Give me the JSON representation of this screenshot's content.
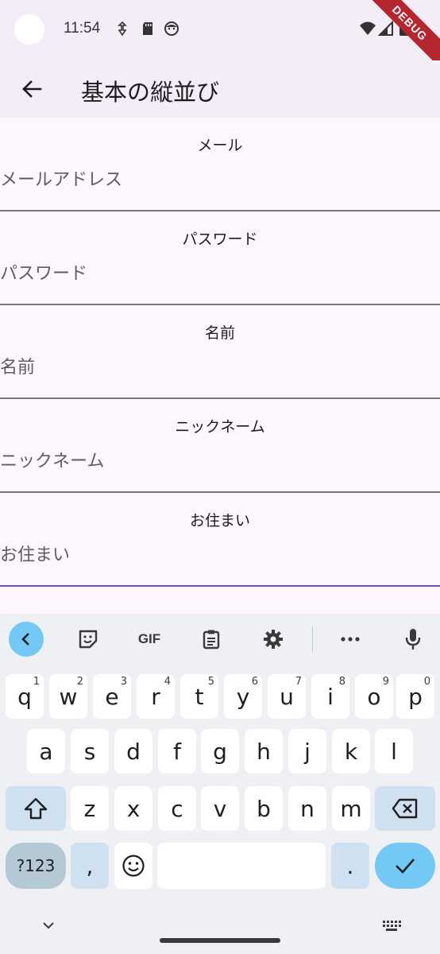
{
  "status_bar": {
    "time": "11:54",
    "icons": [
      "navigation-icon",
      "sd-card-icon",
      "face-icon",
      "wifi-icon",
      "signal-icon",
      "battery-icon"
    ],
    "debug_label": "DEBUG"
  },
  "app_bar": {
    "title": "基本の縦並び",
    "back_icon": "arrow-back-icon"
  },
  "form": {
    "fields": [
      {
        "label": "メール",
        "placeholder": "メールアドレス"
      },
      {
        "label": "パスワード",
        "placeholder": "パスワード"
      },
      {
        "label": "名前",
        "placeholder": "名前"
      },
      {
        "label": "ニックネーム",
        "placeholder": "ニックネーム"
      },
      {
        "label": "お住まい",
        "placeholder": "お住まい"
      }
    ]
  },
  "keyboard": {
    "toolbar": [
      "chevron-left-icon",
      "sticker-icon",
      "gif-icon",
      "clipboard-icon",
      "settings-icon",
      "more-icon",
      "mic-icon"
    ],
    "gif_label": "GIF",
    "row1": [
      {
        "k": "q",
        "h": "1"
      },
      {
        "k": "w",
        "h": "2"
      },
      {
        "k": "e",
        "h": "3"
      },
      {
        "k": "r",
        "h": "4"
      },
      {
        "k": "t",
        "h": "5"
      },
      {
        "k": "y",
        "h": "6"
      },
      {
        "k": "u",
        "h": "7"
      },
      {
        "k": "i",
        "h": "8"
      },
      {
        "k": "o",
        "h": "9"
      },
      {
        "k": "p",
        "h": "0"
      }
    ],
    "row2": [
      "a",
      "s",
      "d",
      "f",
      "g",
      "h",
      "j",
      "k",
      "l"
    ],
    "row3": [
      "z",
      "x",
      "c",
      "v",
      "b",
      "n",
      "m"
    ],
    "symbols_label": "?123",
    "comma": ",",
    "period": ".",
    "colors": {
      "accent": "#73c8f5",
      "modifier": "#cfe1f1",
      "focus_line": "#6b4fbb"
    }
  }
}
